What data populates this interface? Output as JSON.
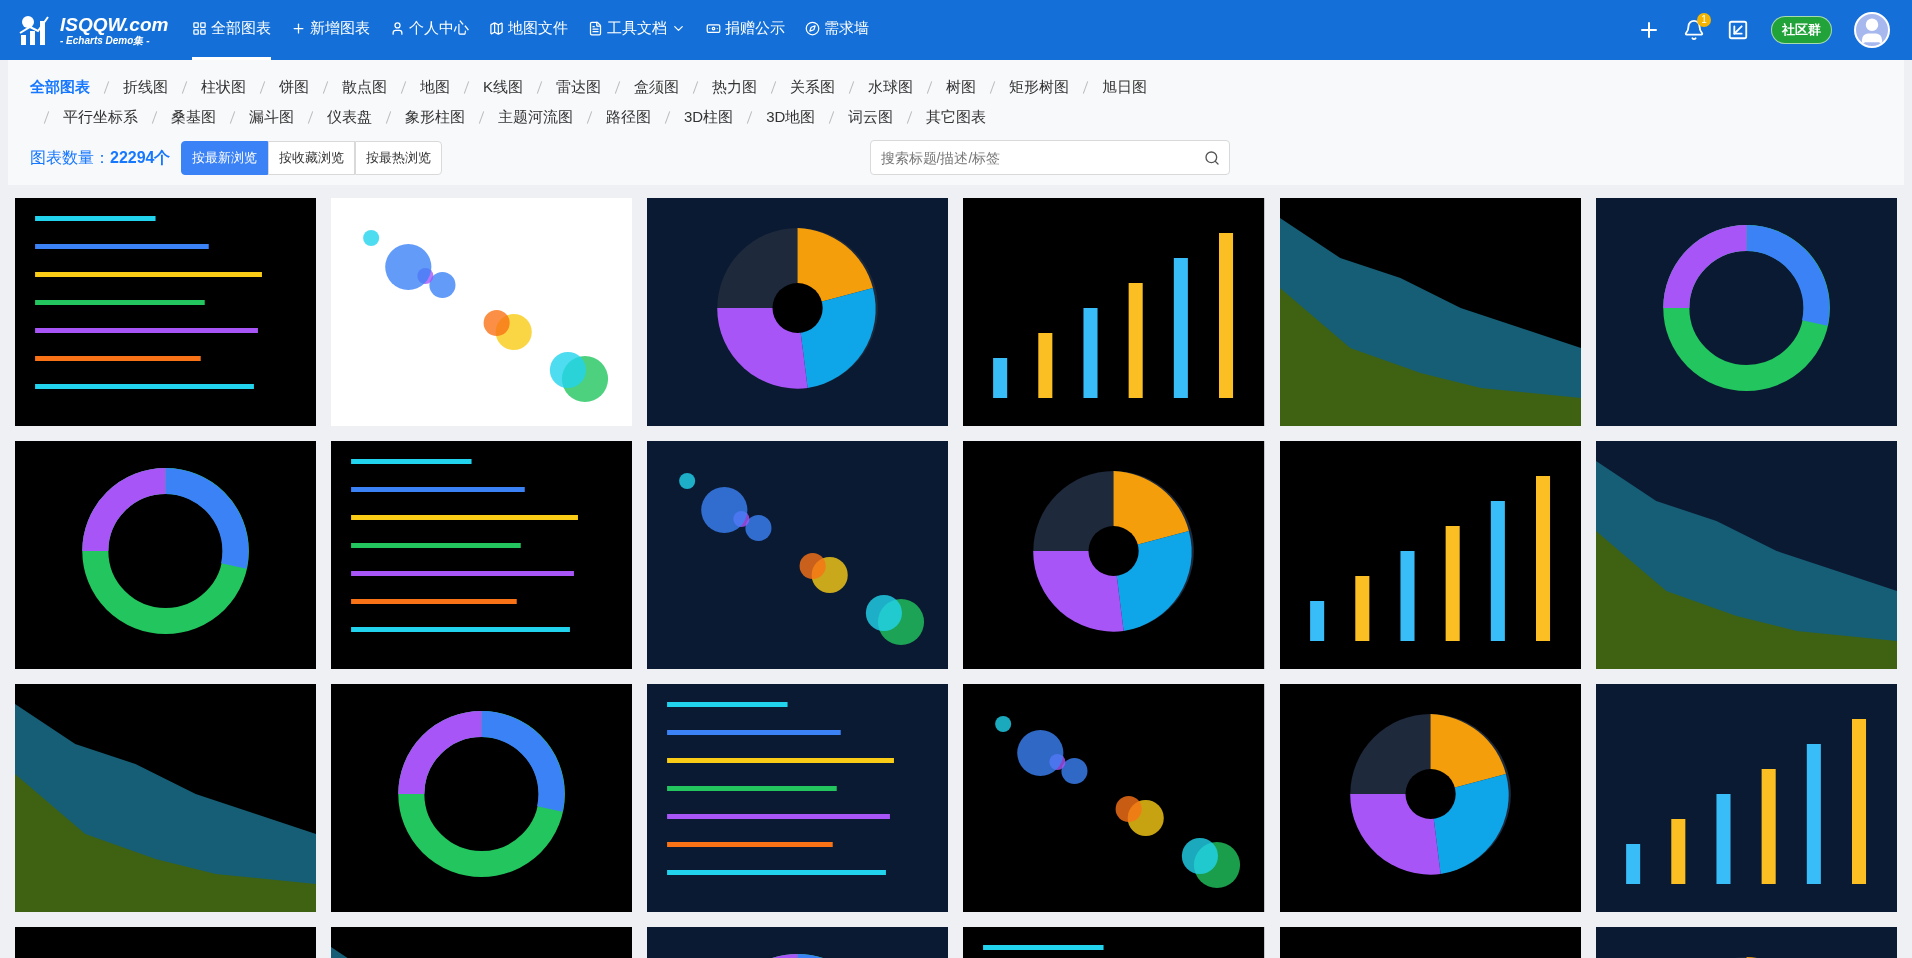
{
  "logo": {
    "title": "ISQQW.com",
    "subtitle": "- Echarts Demo集 -"
  },
  "nav": [
    {
      "label": "全部图表",
      "selected": true,
      "has_menu": false
    },
    {
      "label": "新增图表",
      "selected": false,
      "has_menu": false
    },
    {
      "label": "个人中心",
      "selected": false,
      "has_menu": false
    },
    {
      "label": "地图文件",
      "selected": false,
      "has_menu": false
    },
    {
      "label": "工具文档",
      "selected": false,
      "has_menu": true
    },
    {
      "label": "捐赠公示",
      "selected": false,
      "has_menu": false
    },
    {
      "label": "需求墙",
      "selected": false,
      "has_menu": false
    }
  ],
  "header_actions": {
    "notification_count": "1",
    "community_label": "社区群"
  },
  "category_rows": [
    [
      {
        "label": "全部图表",
        "selected": true
      },
      {
        "label": "折线图",
        "selected": false
      },
      {
        "label": "柱状图",
        "selected": false
      },
      {
        "label": "饼图",
        "selected": false
      },
      {
        "label": "散点图",
        "selected": false
      },
      {
        "label": "地图",
        "selected": false
      },
      {
        "label": "K线图",
        "selected": false
      },
      {
        "label": "雷达图",
        "selected": false
      },
      {
        "label": "盒须图",
        "selected": false
      },
      {
        "label": "热力图",
        "selected": false
      },
      {
        "label": "关系图",
        "selected": false
      },
      {
        "label": "水球图",
        "selected": false
      },
      {
        "label": "树图",
        "selected": false
      },
      {
        "label": "矩形树图",
        "selected": false
      },
      {
        "label": "旭日图",
        "selected": false
      }
    ],
    [
      {
        "label": "平行坐标系",
        "selected": false
      },
      {
        "label": "桑基图",
        "selected": false
      },
      {
        "label": "漏斗图",
        "selected": false
      },
      {
        "label": "仪表盘",
        "selected": false
      },
      {
        "label": "象形柱图",
        "selected": false
      },
      {
        "label": "主题河流图",
        "selected": false
      },
      {
        "label": "路径图",
        "selected": false
      },
      {
        "label": "3D柱图",
        "selected": false
      },
      {
        "label": "3D地图",
        "selected": false
      },
      {
        "label": "词云图",
        "selected": false
      },
      {
        "label": "其它图表",
        "selected": false
      }
    ]
  ],
  "chart_count": "图表数量：**22294个**",
  "sort_buttons": [
    {
      "label": "按最新浏览",
      "selected": true
    },
    {
      "label": "按收藏浏览",
      "selected": false
    },
    {
      "label": "按最热浏览",
      "selected": false
    }
  ],
  "search": {
    "placeholder": "搜索标题/描述/标签"
  }
}
